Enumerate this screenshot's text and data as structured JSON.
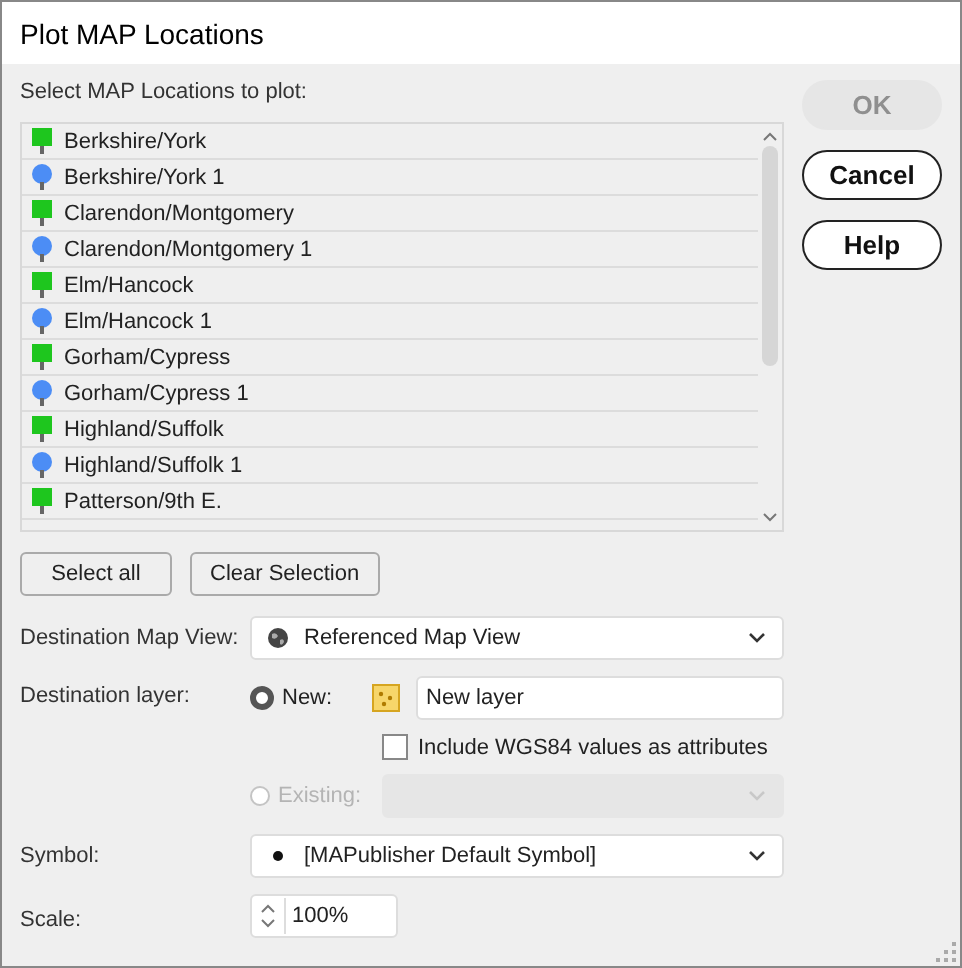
{
  "window": {
    "title": "Plot MAP Locations"
  },
  "list_label": "Select MAP Locations to plot:",
  "locations": [
    {
      "name": "Berkshire/York",
      "kind": "square"
    },
    {
      "name": "Berkshire/York 1",
      "kind": "pin"
    },
    {
      "name": "Clarendon/Montgomery",
      "kind": "square"
    },
    {
      "name": "Clarendon/Montgomery 1",
      "kind": "pin"
    },
    {
      "name": "Elm/Hancock",
      "kind": "square"
    },
    {
      "name": "Elm/Hancock 1",
      "kind": "pin"
    },
    {
      "name": "Gorham/Cypress",
      "kind": "square"
    },
    {
      "name": "Gorham/Cypress 1",
      "kind": "pin"
    },
    {
      "name": "Highland/Suffolk",
      "kind": "square"
    },
    {
      "name": "Highland/Suffolk 1",
      "kind": "pin"
    },
    {
      "name": "Patterson/9th E.",
      "kind": "square"
    }
  ],
  "list_buttons": [
    "Select all",
    "Clear Selection"
  ],
  "side_buttons": [
    {
      "label": "OK",
      "disabled": true
    },
    {
      "label": "Cancel",
      "disabled": false
    },
    {
      "label": "Help",
      "disabled": false
    }
  ],
  "map_view": {
    "label": "Destination Map View:",
    "value": "Referenced Map View"
  },
  "layer": {
    "label": "Destination layer:",
    "options": [
      {
        "label": "New:",
        "selected": true,
        "disabled": false
      },
      {
        "label": "Existing:",
        "selected": false,
        "disabled": true
      }
    ],
    "new_name": "New layer",
    "wgs84": {
      "label": "Include WGS84 values as attributes",
      "checked": false
    }
  },
  "symbol": {
    "label": "Symbol:",
    "value": "[MAPublisher Default Symbol]"
  },
  "scale": {
    "label": "Scale:",
    "value": "100%"
  }
}
